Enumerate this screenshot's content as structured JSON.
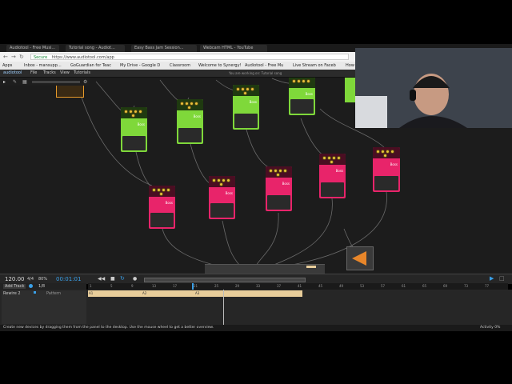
{
  "tabs": [
    {
      "label": "Audiotool - Free Musi..."
    },
    {
      "label": "Tutorial song - Audiot..."
    },
    {
      "label": "Easy Bass Jam Session..."
    },
    {
      "label": "Webcam HTML - YouTube"
    }
  ],
  "address": {
    "secure": "Secure",
    "url": "https://www.audiotool.com/app"
  },
  "bookmarks": [
    {
      "label": "Apps"
    },
    {
      "label": "Inbox - mansupp..."
    },
    {
      "label": "GoGuardian for Teac"
    },
    {
      "label": "My Drive - Google D"
    },
    {
      "label": "Classroom"
    },
    {
      "label": "Welcome to Synergy!"
    },
    {
      "label": "Audiotool - Free Mu"
    },
    {
      "label": "Live Stream on Faceb"
    },
    {
      "label": "How"
    }
  ],
  "app": {
    "logo": "audiotool",
    "menus": [
      "File",
      "Tracks",
      "View",
      "Tutorials"
    ],
    "notice": "You are working on: Tutorial song"
  },
  "pedals": [
    {
      "color": "green",
      "brand": "Boss"
    },
    {
      "color": "green",
      "brand": "Boss"
    },
    {
      "color": "green",
      "brand": "Boss"
    },
    {
      "color": "green",
      "brand": "Boss"
    },
    {
      "color": "pink",
      "brand": "Boss"
    },
    {
      "color": "pink",
      "brand": "Boss"
    },
    {
      "color": "pink",
      "brand": "Boss"
    },
    {
      "color": "pink",
      "brand": "Boss"
    },
    {
      "color": "pink",
      "brand": "Boss"
    }
  ],
  "transport": {
    "bpm": "120.00",
    "sig": "4/4",
    "mode": "80%",
    "time": "00:01:01"
  },
  "tracks": {
    "add_label": "Add Track",
    "zoom": "1/8",
    "track_name": "Rewire 2",
    "track_sub": "Pattern",
    "clip_labels": [
      "A1",
      "A2",
      "A3"
    ]
  },
  "ruler": {
    "marks": [
      "1",
      "5",
      "9",
      "13",
      "17",
      "21",
      "25",
      "29",
      "33",
      "37",
      "41",
      "45",
      "49",
      "53",
      "57",
      "61",
      "65",
      "69",
      "73",
      "77"
    ]
  },
  "status": {
    "hint": "Create new devices by dragging them from the panel to the desktop. Use the mouse wheel to get a better overview.",
    "activity": "Activity 0%"
  },
  "colors": {
    "accent": "#3aa0e8",
    "green_pedal": "#7fd83a",
    "pink_pedal": "#e8246a",
    "clip": "#e8cd9a"
  }
}
